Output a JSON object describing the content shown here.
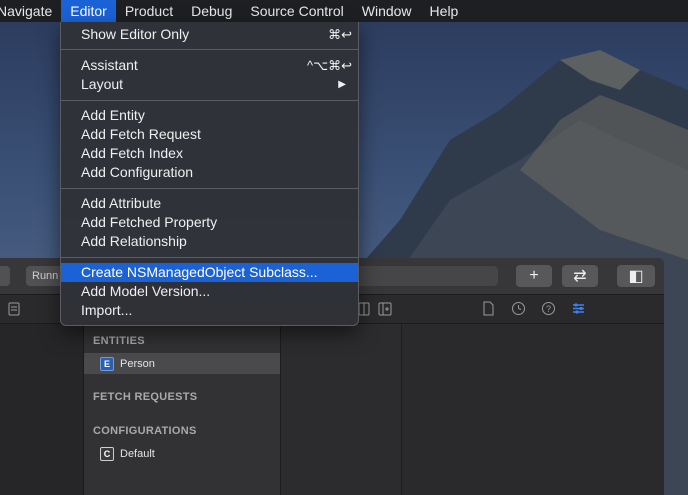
{
  "menubar": {
    "items": [
      {
        "label": "Navigate"
      },
      {
        "label": "Editor"
      },
      {
        "label": "Product"
      },
      {
        "label": "Debug"
      },
      {
        "label": "Source Control"
      },
      {
        "label": "Window"
      },
      {
        "label": "Help"
      }
    ]
  },
  "editor_menu": {
    "show_editor_only": {
      "label": "Show Editor Only",
      "shortcut": "⌘↩"
    },
    "assistant": {
      "label": "Assistant",
      "shortcut": "^⌥⌘↩"
    },
    "layout": {
      "label": "Layout",
      "submenu_glyph": "▶"
    },
    "add_entity": "Add Entity",
    "add_fetch_request": "Add Fetch Request",
    "add_fetch_index": "Add Fetch Index",
    "add_configuration": "Add Configuration",
    "add_attribute": "Add Attribute",
    "add_fetched_property": "Add Fetched Property",
    "add_relationship": "Add Relationship",
    "create_subclass": "Create NSManagedObject Subclass...",
    "add_model_version": "Add Model Version...",
    "import": "Import..."
  },
  "toolbar": {
    "scheme_left": ".)",
    "scheme_running": "Runn",
    "plus_glyph": "+",
    "swap_glyph": "⇄",
    "panel_glyph": "◧"
  },
  "outline": {
    "entities_header": "ENTITIES",
    "entities": [
      {
        "badge": "E",
        "name": "Person"
      }
    ],
    "fetch_requests_header": "FETCH REQUESTS",
    "configurations_header": "CONFIGURATIONS",
    "configurations": [
      {
        "badge": "C",
        "name": "Default"
      }
    ]
  },
  "colors": {
    "highlight": "#1b62d6",
    "menu_bg": "#303238",
    "inspector_active": "#3b82f6"
  }
}
